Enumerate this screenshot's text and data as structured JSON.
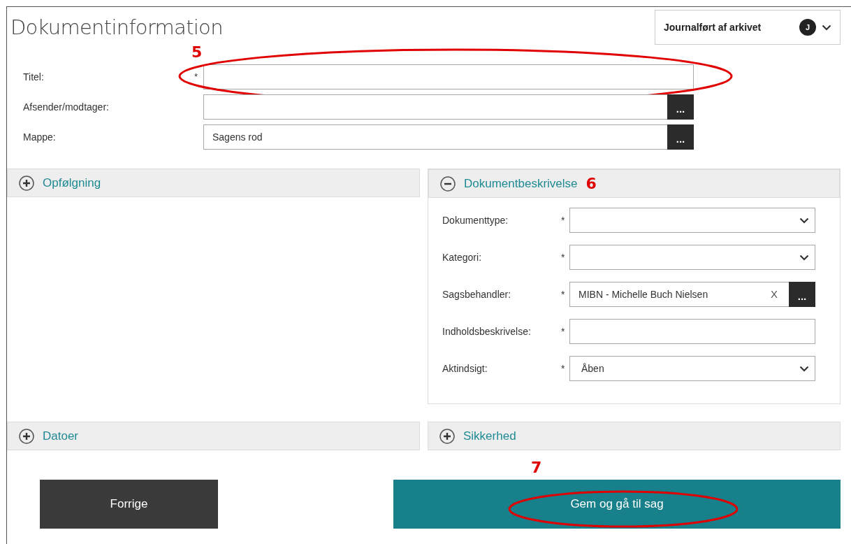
{
  "title": "Dokumentinformation",
  "status_menu": {
    "label": "Journalført af arkivet",
    "avatar": "J"
  },
  "fields": [
    {
      "kind": "text",
      "label": "Titel:",
      "marker": "*",
      "annotation": "5"
    },
    {
      "kind": "lookup",
      "label": "Afsender/modtager:",
      "button": "..."
    },
    {
      "kind": "lookup",
      "label": "Mappe:",
      "value": "Sagens rod",
      "button": "..."
    }
  ],
  "sections": [
    {
      "title": "Opfølgning",
      "expanded": false
    },
    {
      "title": "Dokumentbeskrivelse",
      "expanded": true,
      "annotation": "6",
      "fields": [
        {
          "kind": "select",
          "label": "Dokumenttype:",
          "marker": "*"
        },
        {
          "kind": "select",
          "label": "Kategori:",
          "marker": "*"
        },
        {
          "kind": "lookup",
          "label": "Sagsbehandler:",
          "marker": "*",
          "value": "MIBN - Michelle Buch Nielsen",
          "clear": "X",
          "button": "..."
        },
        {
          "kind": "text",
          "label": "Indholdsbeskrivelse:",
          "marker": "*"
        },
        {
          "kind": "select",
          "label": "Aktindsigt:",
          "marker": "*",
          "value": "Åben"
        }
      ]
    },
    {
      "title": "Datoer",
      "expanded": false
    },
    {
      "title": "Sikkerhed",
      "expanded": false
    }
  ],
  "buttons": [
    {
      "kind": "secondary",
      "label": "Forrige"
    },
    {
      "kind": "primary",
      "label": "Gem og gå til sag",
      "annotation": "7"
    }
  ]
}
